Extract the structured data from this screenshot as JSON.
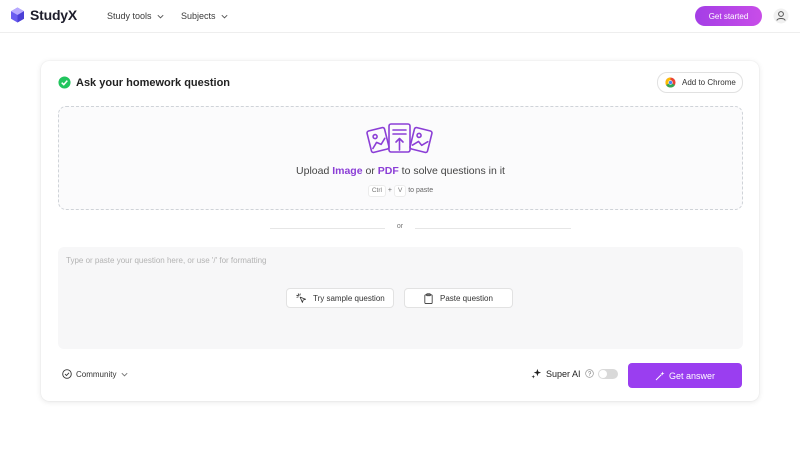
{
  "header": {
    "brand": "StudyX",
    "nav": [
      {
        "label": "Study tools"
      },
      {
        "label": "Subjects"
      }
    ],
    "cta_label": "Get started"
  },
  "card": {
    "title": "Ask your homework question",
    "chrome_label": "Add to Chrome",
    "upload": {
      "prefix": "Upload ",
      "image_word": "Image",
      "or_word": " or ",
      "pdf_word": "PDF",
      "suffix": " to solve questions in it",
      "kbd_ctrl": "Ctrl",
      "plus": "+",
      "kbd_v": "V",
      "paste_text": "to paste"
    },
    "divider_text": "or",
    "question": {
      "placeholder": "Type or paste your question here, or use '/' for formatting",
      "sample_label": "Try sample question",
      "paste_label": "Paste question"
    },
    "footer": {
      "community_label": "Community",
      "super_ai_label": "Super AI",
      "get_answer_label": "Get answer"
    }
  },
  "colors": {
    "brand_purple": "#9a3ef0",
    "success_green": "#22c55e"
  }
}
